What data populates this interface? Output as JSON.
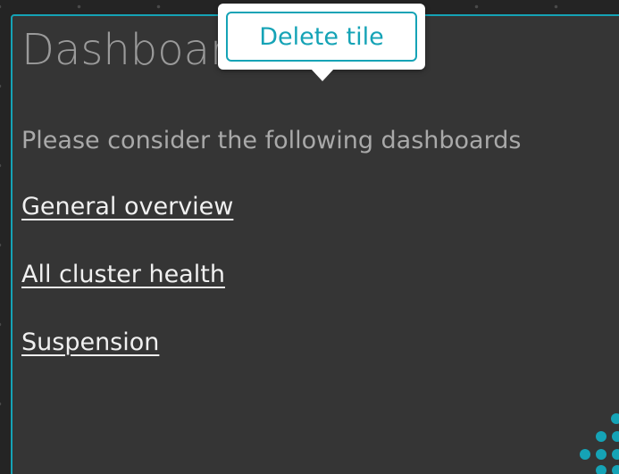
{
  "tile": {
    "title": "Dashboards",
    "intro": "Please consider the following dashboards",
    "links": [
      {
        "label": "General overview"
      },
      {
        "label": "All cluster health"
      },
      {
        "label": "Suspension"
      }
    ]
  },
  "tooltip": {
    "delete_label": "Delete tile"
  },
  "colors": {
    "accent": "#15a3b6",
    "background": "#242424",
    "tile_background": "#353535",
    "link_text": "#f0f0f0",
    "muted_text": "#a9a9a9"
  },
  "icons": {
    "logo": "dots-logo-icon"
  }
}
